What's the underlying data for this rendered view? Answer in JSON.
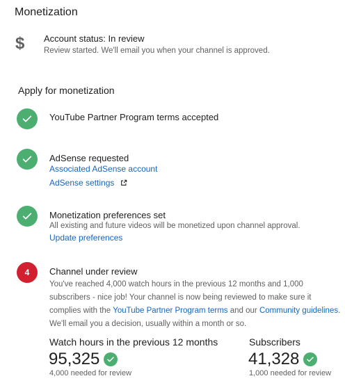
{
  "page": {
    "title": "Monetization"
  },
  "account_status": {
    "icon": "dollar-icon",
    "title": "Account status: In review",
    "subtitle": "Review started. We'll email you when your channel is approved."
  },
  "apply": {
    "title": "Apply for monetization",
    "steps": [
      {
        "status": "done",
        "title": "YouTube Partner Program terms accepted"
      },
      {
        "status": "done",
        "title": "AdSense requested",
        "links": [
          "Associated AdSense account",
          "AdSense settings"
        ]
      },
      {
        "status": "done",
        "title": "Monetization preferences set",
        "subtitle": "All existing and future videos will be monetized upon channel approval.",
        "link": "Update preferences"
      },
      {
        "status": "pending",
        "badge": "4",
        "title": "Channel under review"
      }
    ],
    "review": {
      "text1": "You've reached 4,000 watch hours in the previous 12 months and 1,000 subscribers - nice job! Your channel is now being reviewed to make sure it complies with the ",
      "link1": "YouTube Partner Program terms",
      "text2": " and our ",
      "link2": "Community guidelines",
      "text3": ". We'll email you a decision, usually within a month or so."
    }
  },
  "stats": {
    "watch_hours": {
      "label": "Watch hours in the previous 12 months",
      "value": "95,325",
      "requirement": "4,000 needed for review"
    },
    "subscribers": {
      "label": "Subscribers",
      "value": "41,328",
      "requirement": "1,000 needed for review"
    }
  },
  "colors": {
    "success": "#4caf71",
    "pending": "#d32030",
    "link": "#1565c0"
  }
}
